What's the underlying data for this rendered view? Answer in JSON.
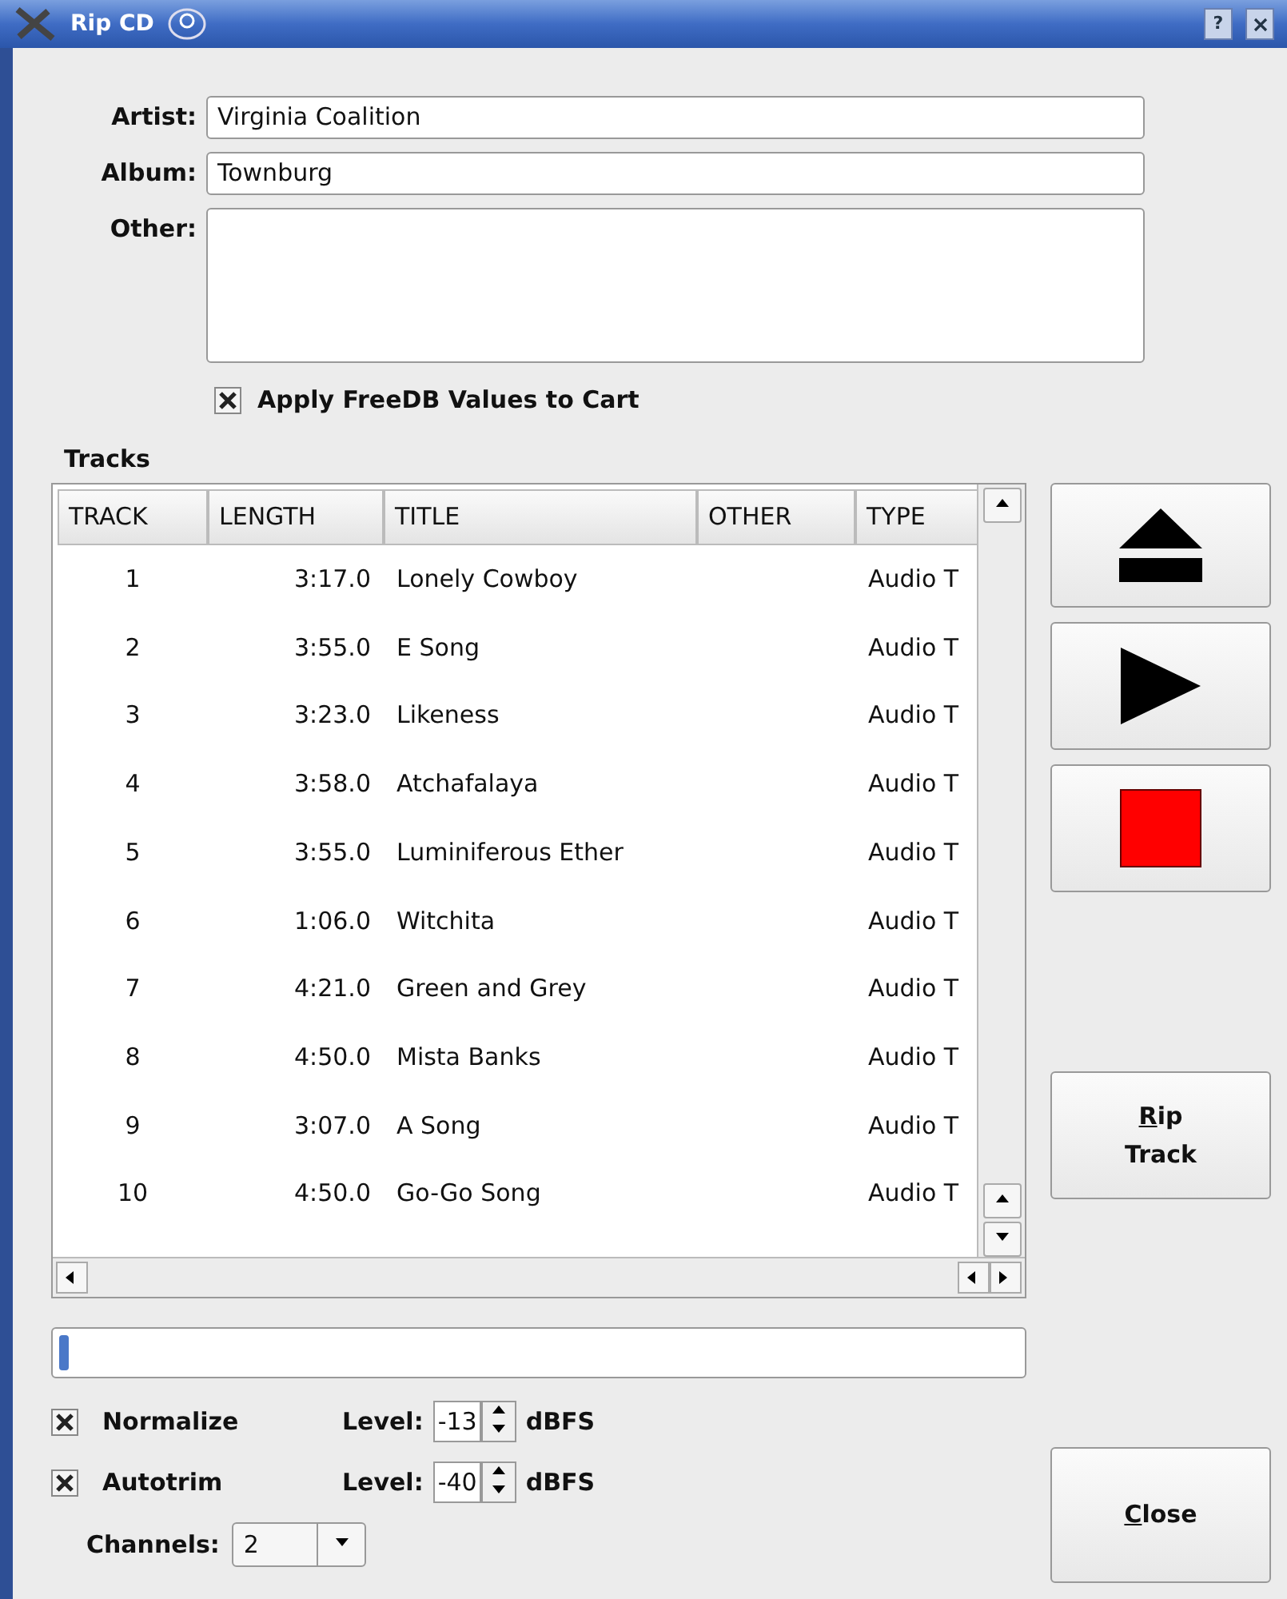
{
  "window": {
    "title": "Rip CD",
    "help_label": "?"
  },
  "fields": [
    {
      "label": "Artist:",
      "value": "Virginia Coalition"
    },
    {
      "label": "Album:",
      "value": "Townburg"
    }
  ],
  "other": {
    "label": "Other:"
  },
  "apply_freedb": {
    "label": "Apply FreeDB Values to Cart",
    "checked": true
  },
  "tracks": {
    "label": "Tracks",
    "columns": [
      "TRACK",
      "LENGTH",
      "TITLE",
      "OTHER",
      "TYPE"
    ],
    "rows": [
      [
        "1",
        "3:17.0",
        "Lonely Cowboy",
        "",
        "Audio T"
      ],
      [
        "2",
        "3:55.0",
        "E Song",
        "",
        "Audio T"
      ],
      [
        "3",
        "3:23.0",
        "Likeness",
        "",
        "Audio T"
      ],
      [
        "4",
        "3:58.0",
        "Atchafalaya",
        "",
        "Audio T"
      ],
      [
        "5",
        "3:55.0",
        "Luminiferous Ether",
        "",
        "Audio T"
      ],
      [
        "6",
        "1:06.0",
        "Witchita",
        "",
        "Audio T"
      ],
      [
        "7",
        "4:21.0",
        "Green and Grey",
        "",
        "Audio T"
      ],
      [
        "8",
        "4:50.0",
        "Mista Banks",
        "",
        "Audio T"
      ],
      [
        "9",
        "3:07.0",
        "A Song",
        "",
        "Audio T"
      ],
      [
        "10",
        "4:50.0",
        "Go-Go Song",
        "",
        "Audio T"
      ]
    ]
  },
  "rip_button": {
    "lines": [
      "Rip",
      "Track"
    ]
  },
  "progress": {
    "level": 0.01
  },
  "options": [
    {
      "label": "Normalize",
      "checked": true,
      "level_label": "Level:",
      "value": "-13",
      "unit": "dBFS"
    },
    {
      "label": "Autotrim",
      "checked": true,
      "level_label": "Level:",
      "value": "-40",
      "unit": "dBFS"
    }
  ],
  "channels": {
    "label": "Channels:",
    "value": "2"
  },
  "close_button": {
    "label": "Close"
  }
}
